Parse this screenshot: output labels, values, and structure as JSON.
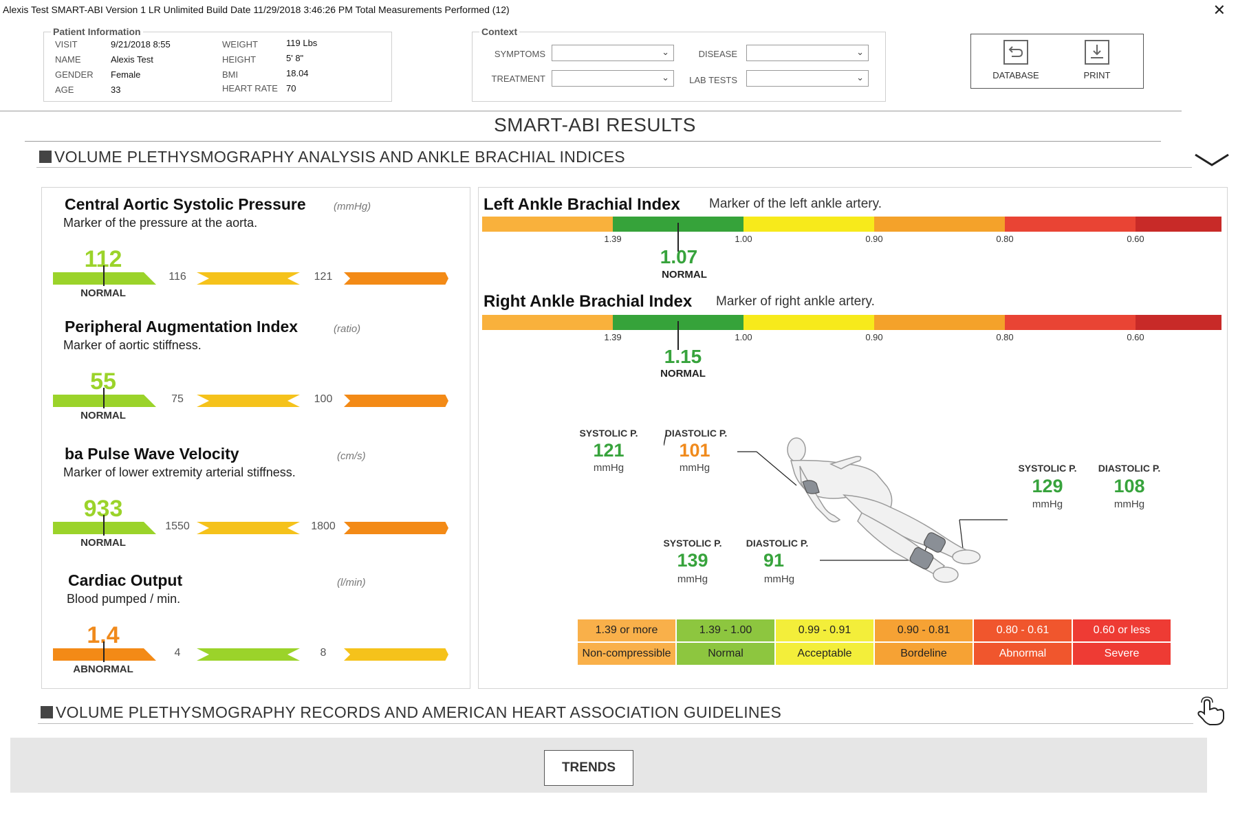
{
  "titlebar": {
    "text": "Alexis Test SMART-ABI Version 1 LR Unlimited Build Date 11/29/2018 3:46:26 PM    Total Measurements Performed (12)",
    "close": "✕"
  },
  "patient": {
    "label": "Patient Information",
    "fields": [
      {
        "key": "VISIT",
        "value": "9/21/2018   8:55"
      },
      {
        "key": "NAME",
        "value": "Alexis Test"
      },
      {
        "key": "GENDER",
        "value": "Female"
      },
      {
        "key": "AGE",
        "value": "33"
      },
      {
        "key": "WEIGHT",
        "value": "119 Lbs"
      },
      {
        "key": "HEIGHT",
        "value": "5'  8\""
      },
      {
        "key": "BMI",
        "value": "18.04"
      },
      {
        "key": "HEART RATE",
        "value": "70"
      }
    ]
  },
  "context": {
    "label": "Context",
    "symptoms": "SYMPTOMS",
    "treatment": "TREATMENT",
    "disease": "DISEASE",
    "lab_tests": "LAB TESTS"
  },
  "toolbar": {
    "database": "DATABASE",
    "print": "PRINT"
  },
  "results_title": "SMART-ABI RESULTS",
  "section1": "VOLUME PLETHYSMOGRAPHY ANALYSIS AND ANKLE BRACHIAL INDICES",
  "section2": "VOLUME PLETHYSMOGRAPHY RECORDS AND AMERICAN HEART ASSOCIATION GUIDELINES",
  "metrics": [
    {
      "title": "Central Aortic Systolic Pressure",
      "unit": "(mmHg)",
      "desc": "Marker of the pressure at the aorta.",
      "value": "112",
      "status": "NORMAL",
      "t1": "116",
      "t2": "121",
      "value_color": "#9bd32a"
    },
    {
      "title": "Peripheral Augmentation Index",
      "unit": "(ratio)",
      "desc": "Marker of aortic stiffness.",
      "value": "55",
      "status": "NORMAL",
      "t1": "75",
      "t2": "100",
      "value_color": "#9bd32a"
    },
    {
      "title": "ba Pulse Wave Velocity",
      "unit": "(cm/s)",
      "desc": "Marker of lower extremity arterial stiffness.",
      "value": "933",
      "status": "NORMAL",
      "t1": "1550",
      "t2": "1800",
      "value_color": "#9bd32a"
    },
    {
      "title": "Cardiac Output",
      "unit": "(l/min)",
      "desc": "Blood pumped / min.",
      "value": "1.4",
      "status": "ABNORMAL",
      "t1": "4",
      "t2": "8",
      "value_color": "#f08a1c"
    }
  ],
  "abi": [
    {
      "title": "Left Ankle Brachial Index",
      "desc": "Marker of the left ankle artery.",
      "value": "1.07",
      "status": "NORMAL"
    },
    {
      "title": "Right Ankle Brachial Index",
      "desc": "Marker of right ankle artery.",
      "value": "1.15",
      "status": "NORMAL"
    }
  ],
  "abi_ticks": [
    "1.39",
    "1.00",
    "0.90",
    "0.80",
    "0.60"
  ],
  "pressures": {
    "systolic_label": "SYSTOLIC P.",
    "diastolic_label": "DIASTOLIC P.",
    "unit": "mmHg",
    "arm": {
      "systolic": "121",
      "diastolic": "101"
    },
    "right_ankle": {
      "systolic": "129",
      "diastolic": "108"
    },
    "left_ankle": {
      "systolic": "139",
      "diastolic": "91"
    }
  },
  "legend": {
    "ranges": [
      "1.39 or more",
      "1.39 - 1.00",
      "0.99 - 0.91",
      "0.90 - 0.81",
      "0.80 - 0.61",
      "0.60 or less"
    ],
    "labels": [
      "Non-compressible",
      "Normal",
      "Acceptable",
      "Bordeline",
      "Abnormal",
      "Severe"
    ],
    "colors": [
      "#f9b04a",
      "#8dc63f",
      "#f3ee3a",
      "#f6a234",
      "#f0562d",
      "#ee3b34"
    ]
  },
  "colors": {
    "green": "#9bd32a",
    "yellow": "#f5c21b",
    "orange": "#f38a16",
    "abi_orange": "#f9b13c",
    "abi_green": "#36a33a",
    "abi_yellow": "#f7ea1b",
    "abi_orange2": "#f4a22a",
    "abi_red": "#e94434",
    "abi_darkred": "#c82a28"
  },
  "trends": "TRENDS"
}
